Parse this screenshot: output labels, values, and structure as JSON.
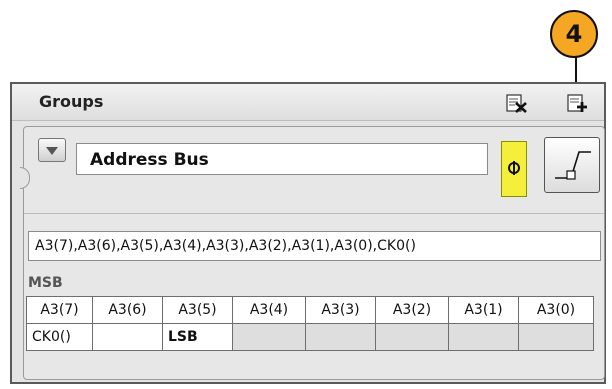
{
  "callout": {
    "number": "4"
  },
  "panel": {
    "title": "Groups",
    "delete_group_icon": "delete-group-icon",
    "add_group_icon": "add-group-icon"
  },
  "group": {
    "name": "Address Bus",
    "polarity_icon": "polarity-icon",
    "trigger_icon": "rising-edge-icon",
    "channels": "A3(7),A3(6),A3(5),A3(4),A3(3),A3(2),A3(1),A3(0),CK0()",
    "msb_label": "MSB",
    "bits_row1": [
      "A3(7)",
      "A3(6)",
      "A3(5)",
      "A3(4)",
      "A3(3)",
      "A3(2)",
      "A3(1)",
      "A3(0)"
    ],
    "bits_row2": [
      "CK0()",
      "",
      "LSB",
      "",
      "",
      "",
      "",
      ""
    ]
  },
  "colors": {
    "callout": "#f5a623",
    "polarity": "#f3ef3a"
  }
}
